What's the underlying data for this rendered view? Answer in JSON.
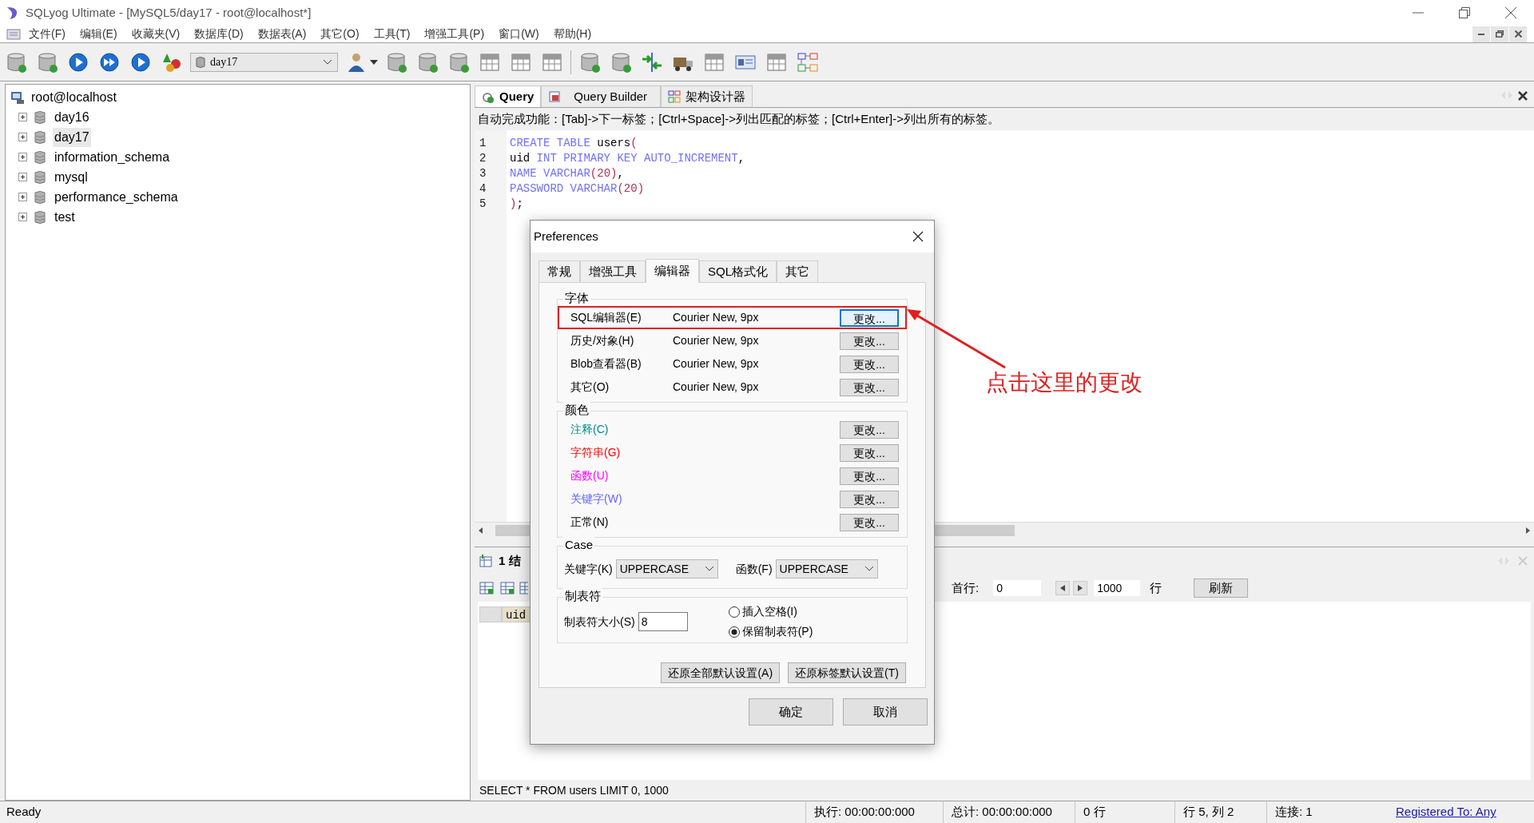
{
  "window": {
    "title": "SQLyog Ultimate - [MySQL5/day17 - root@localhost*]"
  },
  "menu": [
    {
      "label": "文件(F)"
    },
    {
      "label": "编辑(E)"
    },
    {
      "label": "收藏夹(V)"
    },
    {
      "label": "数据库(D)"
    },
    {
      "label": "数据表(A)"
    },
    {
      "label": "其它(O)"
    },
    {
      "label": "工具(T)"
    },
    {
      "label": "增强工具(P)"
    },
    {
      "label": "窗口(W)"
    },
    {
      "label": "帮助(H)"
    }
  ],
  "toolbar": {
    "database_select": "day17"
  },
  "object_browser": {
    "root": "root@localhost",
    "items": [
      {
        "label": "day16",
        "selected": false,
        "expanded": false
      },
      {
        "label": "day17",
        "selected": true,
        "expanded": false
      },
      {
        "label": "information_schema",
        "selected": false,
        "expanded": false
      },
      {
        "label": "mysql",
        "selected": false,
        "expanded": false
      },
      {
        "label": "performance_schema",
        "selected": false,
        "expanded": false
      },
      {
        "label": "test",
        "selected": false,
        "expanded": false
      }
    ]
  },
  "editor_tabs": [
    {
      "label": "Query",
      "selected": true
    },
    {
      "label": "Query Builder",
      "selected": false
    },
    {
      "label": "架构设计器",
      "selected": false
    }
  ],
  "autocomplete_hint": "自动完成功能：[Tab]->下一标签；[Ctrl+Space]->列出匹配的标签；[Ctrl+Enter]->列出所有的标签。",
  "editor": {
    "lines": [
      {
        "number": "1",
        "tokens": [
          {
            "text": "CREATE TABLE",
            "kind": "keyword"
          },
          {
            "text": " users",
            "kind": "plain"
          },
          {
            "text": "(",
            "kind": "punct"
          }
        ]
      },
      {
        "number": "2",
        "tokens": [
          {
            "text": "uid ",
            "kind": "plain"
          },
          {
            "text": "INT PRIMARY KEY AUTO_INCREMENT",
            "kind": "keyword"
          },
          {
            "text": ",",
            "kind": "plain"
          }
        ]
      },
      {
        "number": "3",
        "tokens": [
          {
            "text": "NAME VARCHAR",
            "kind": "keyword"
          },
          {
            "text": "(20)",
            "kind": "punct"
          },
          {
            "text": ",",
            "kind": "plain"
          }
        ]
      },
      {
        "number": "4",
        "tokens": [
          {
            "text": "PASSWORD VARCHAR",
            "kind": "keyword"
          },
          {
            "text": "(20)",
            "kind": "punct"
          }
        ]
      },
      {
        "number": "5",
        "tokens": [
          {
            "text": ")",
            "kind": "punct"
          },
          {
            "text": ";",
            "kind": "plain"
          }
        ]
      }
    ]
  },
  "results": {
    "tab": "1 结",
    "first_row_label": "首行:",
    "first_row": "0",
    "row_count": "1000",
    "rows_unit": "行",
    "refresh": "刷新",
    "columns": [
      "uid"
    ]
  },
  "query_echo": "SELECT * FROM users LIMIT 0, 1000",
  "status_bar": {
    "ready": "Ready",
    "cells": [
      "执行: 00:00:00:000",
      "总计: 00:00:00:000",
      "0 行",
      "行 5, 列 2",
      "连接: 1"
    ],
    "link": "Registered To: Any"
  },
  "dialog": {
    "title": "Preferences",
    "tabs": [
      {
        "label": "常规",
        "selected": false
      },
      {
        "label": "增强工具",
        "selected": false
      },
      {
        "label": "编辑器",
        "selected": true
      },
      {
        "label": "SQL格式化",
        "selected": false
      },
      {
        "label": "其它",
        "selected": false
      }
    ],
    "font_group": {
      "title": "字体",
      "rows": [
        {
          "label": "SQL编辑器(E)",
          "value": "Courier New, 9px",
          "button": "更改...",
          "highlighted": true,
          "focused": true
        },
        {
          "label": "历史/对象(H)",
          "value": "Courier New, 9px",
          "button": "更改...",
          "highlighted": false,
          "focused": false
        },
        {
          "label": "Blob查看器(B)",
          "value": "Courier New, 9px",
          "button": "更改...",
          "highlighted": false,
          "focused": false
        },
        {
          "label": "其它(O)",
          "value": "Courier New, 9px",
          "button": "更改...",
          "highlighted": false,
          "focused": false
        }
      ]
    },
    "color_group": {
      "title": "颜色",
      "rows": [
        {
          "label": "注释(C)",
          "color": "#008b8b",
          "button": "更改..."
        },
        {
          "label": "字符串(G)",
          "color": "#ff0000",
          "button": "更改..."
        },
        {
          "label": "函数(U)",
          "color": "#ff00ff",
          "button": "更改..."
        },
        {
          "label": "关键字(W)",
          "color": "#6464ff",
          "button": "更改..."
        },
        {
          "label": "正常(N)",
          "color": "#000000",
          "button": "更改..."
        }
      ]
    },
    "case_group": {
      "title": "Case",
      "keyword_label": "关键字(K)",
      "keyword_value": "UPPERCASE",
      "function_label": "函数(F)",
      "function_value": "UPPERCASE"
    },
    "tab_group": {
      "title": "制表符",
      "size_label": "制表符大小(S)",
      "size_value": "8",
      "options": [
        {
          "label": "插入空格(I)",
          "selected": false
        },
        {
          "label": "保留制表符(P)",
          "selected": true
        }
      ]
    },
    "reset_buttons": [
      "还原全部默认设置(A)",
      "还原标签默认设置(T)"
    ],
    "buttons": [
      "确定",
      "取消"
    ]
  },
  "annotation": {
    "text": "点击这里的更改"
  }
}
